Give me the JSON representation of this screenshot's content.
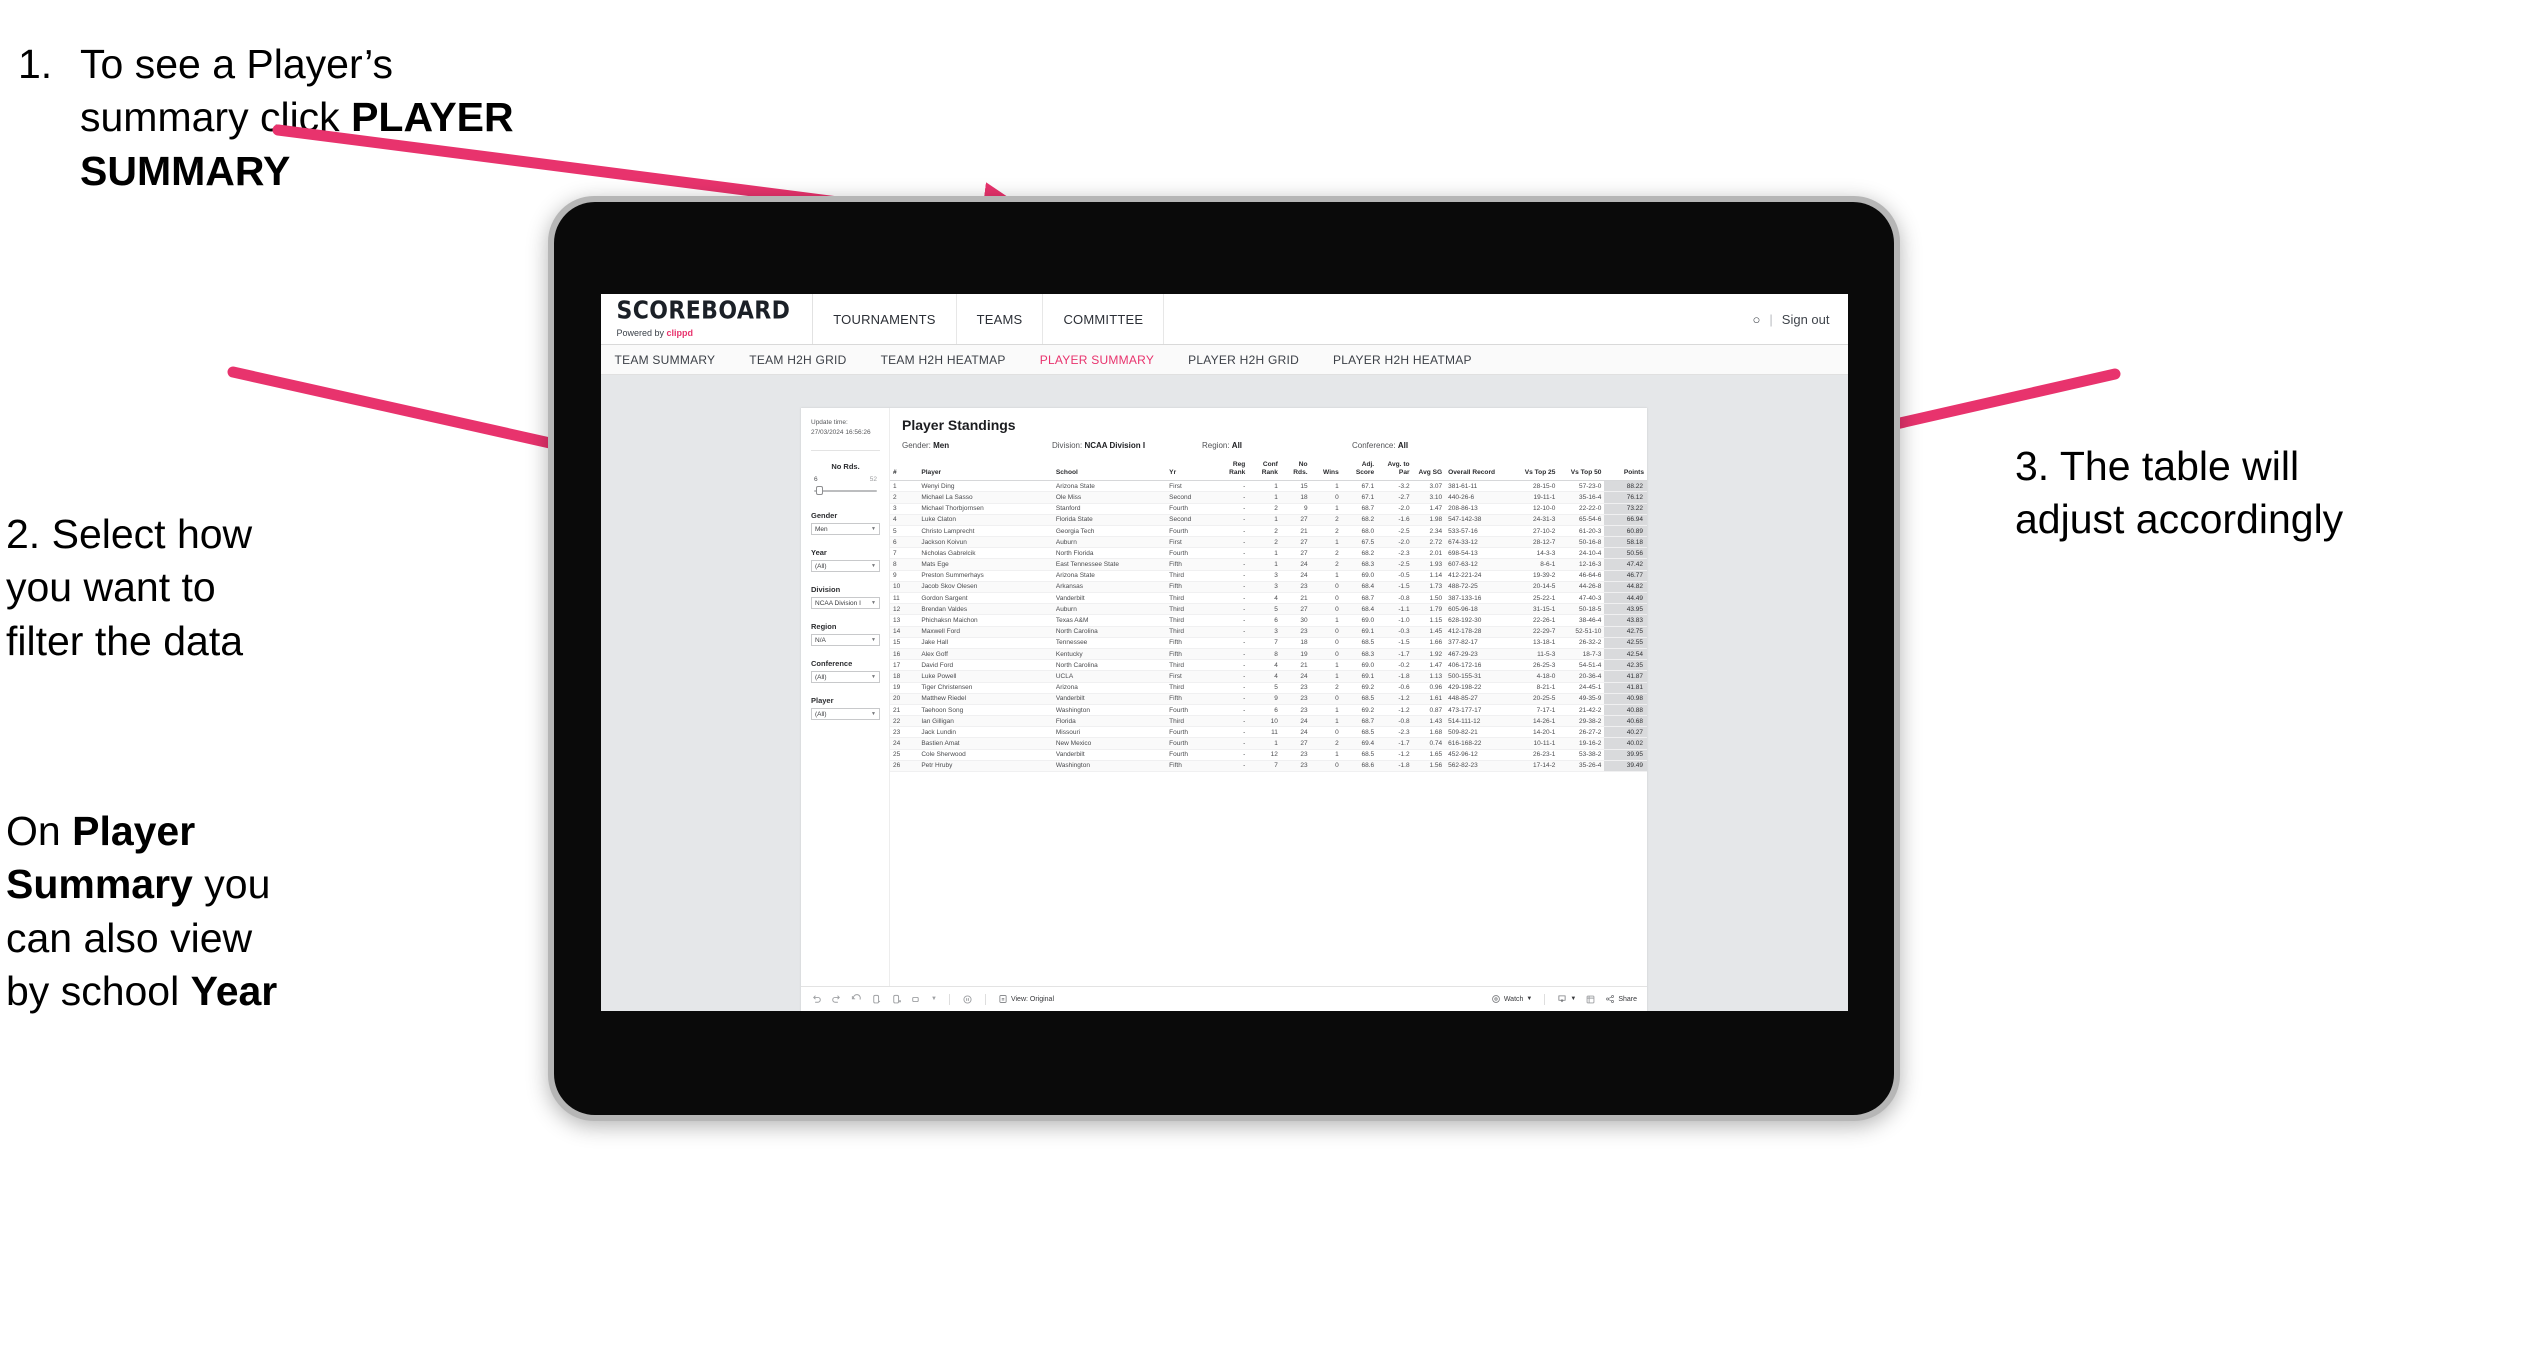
{
  "annotations": {
    "one": {
      "number": "1.",
      "line1": "To see a Player’s",
      "line2_pre": "summary click ",
      "line2_bold": "PLAYER",
      "line3_bold": "SUMMARY"
    },
    "two": {
      "number": "2.",
      "line1": "Select how",
      "line2": "you want to",
      "line3": "filter the data"
    },
    "two_b": {
      "l1_pre": "On ",
      "l1_bold": "Player",
      "l2_bold": "Summary",
      "l2_post": " you",
      "l3": "can also view",
      "l4_pre": "by school ",
      "l4_bold": "Year"
    },
    "three": {
      "line1": "3. The table will",
      "line2": "adjust accordingly"
    }
  },
  "app": {
    "brand": {
      "word": "SCOREBOARD",
      "powered_pre": "Powered by ",
      "powered_brand": "clippd"
    },
    "topnav": [
      "TOURNAMENTS",
      "TEAMS",
      "COMMITTEE"
    ],
    "topright": {
      "icon": "user-icon",
      "glyph": "○",
      "sep": "|",
      "signout": "Sign out"
    },
    "subnav": [
      {
        "label": "TEAM SUMMARY",
        "active": false
      },
      {
        "label": "TEAM H2H GRID",
        "active": false
      },
      {
        "label": "TEAM H2H HEATMAP",
        "active": false
      },
      {
        "label": "PLAYER SUMMARY",
        "active": true
      },
      {
        "label": "PLAYER H2H GRID",
        "active": false
      },
      {
        "label": "PLAYER H2H HEATMAP",
        "active": false
      }
    ],
    "accent": "#e8336d"
  },
  "filters": {
    "update_time_label": "Update time:",
    "update_time_value": "27/03/2024 16:56:26",
    "slider": {
      "title": "No Rds.",
      "min": "6",
      "max": "52"
    },
    "selects": [
      {
        "label": "Gender",
        "value": "Men"
      },
      {
        "label": "Year",
        "value": "(All)"
      },
      {
        "label": "Division",
        "value": "NCAA Division I"
      },
      {
        "label": "Region",
        "value": "N/A"
      },
      {
        "label": "Conference",
        "value": "(All)"
      },
      {
        "label": "Player",
        "value": "(All)"
      }
    ]
  },
  "viz": {
    "title": "Player Standings",
    "subhead": [
      {
        "label": "Gender: ",
        "value": "Men"
      },
      {
        "label": "Division: ",
        "value": "NCAA Division I"
      },
      {
        "label": "Region: ",
        "value": "All"
      },
      {
        "label": "Conference: ",
        "value": "All"
      }
    ],
    "columns": [
      "#",
      "Player",
      "School",
      "Yr",
      "Reg Rank",
      "Conf Rank",
      "No Rds.",
      "Wins",
      "Adj. Score",
      "Avg. to Par",
      "Avg SG",
      "Overall Record",
      "Vs Top 25",
      "Vs Top 50",
      "Points"
    ],
    "rows": [
      [
        "1",
        "Wenyi Ding",
        "Arizona State",
        "First",
        "-",
        "1",
        "15",
        "1",
        "67.1",
        "-3.2",
        "3.07",
        "381-61-11",
        "28-15-0",
        "57-23-0",
        "88.22"
      ],
      [
        "2",
        "Michael La Sasso",
        "Ole Miss",
        "Second",
        "-",
        "1",
        "18",
        "0",
        "67.1",
        "-2.7",
        "3.10",
        "440-26-6",
        "19-11-1",
        "35-16-4",
        "76.12"
      ],
      [
        "3",
        "Michael Thorbjornsen",
        "Stanford",
        "Fourth",
        "-",
        "2",
        "9",
        "1",
        "68.7",
        "-2.0",
        "1.47",
        "208-86-13",
        "12-10-0",
        "22-22-0",
        "73.22"
      ],
      [
        "4",
        "Luke Claton",
        "Florida State",
        "Second",
        "-",
        "1",
        "27",
        "2",
        "68.2",
        "-1.6",
        "1.98",
        "547-142-38",
        "24-31-3",
        "65-54-6",
        "66.94"
      ],
      [
        "5",
        "Christo Lamprecht",
        "Georgia Tech",
        "Fourth",
        "-",
        "2",
        "21",
        "2",
        "68.0",
        "-2.5",
        "2.34",
        "533-57-16",
        "27-10-2",
        "61-20-3",
        "60.89"
      ],
      [
        "6",
        "Jackson Koivun",
        "Auburn",
        "First",
        "-",
        "2",
        "27",
        "1",
        "67.5",
        "-2.0",
        "2.72",
        "674-33-12",
        "28-12-7",
        "50-16-8",
        "58.18"
      ],
      [
        "7",
        "Nicholas Gabrelcik",
        "North Florida",
        "Fourth",
        "-",
        "1",
        "27",
        "2",
        "68.2",
        "-2.3",
        "2.01",
        "698-54-13",
        "14-3-3",
        "24-10-4",
        "50.56"
      ],
      [
        "8",
        "Mats Ege",
        "East Tennessee State",
        "Fifth",
        "-",
        "1",
        "24",
        "2",
        "68.3",
        "-2.5",
        "1.93",
        "607-63-12",
        "8-6-1",
        "12-16-3",
        "47.42"
      ],
      [
        "9",
        "Preston Summerhays",
        "Arizona State",
        "Third",
        "-",
        "3",
        "24",
        "1",
        "69.0",
        "-0.5",
        "1.14",
        "412-221-24",
        "19-39-2",
        "46-64-6",
        "46.77"
      ],
      [
        "10",
        "Jacob Skov Olesen",
        "Arkansas",
        "Fifth",
        "-",
        "3",
        "23",
        "0",
        "68.4",
        "-1.5",
        "1.73",
        "488-72-25",
        "20-14-5",
        "44-26-8",
        "44.82"
      ],
      [
        "11",
        "Gordon Sargent",
        "Vanderbilt",
        "Third",
        "-",
        "4",
        "21",
        "0",
        "68.7",
        "-0.8",
        "1.50",
        "387-133-16",
        "25-22-1",
        "47-40-3",
        "44.49"
      ],
      [
        "12",
        "Brendan Valdes",
        "Auburn",
        "Third",
        "-",
        "5",
        "27",
        "0",
        "68.4",
        "-1.1",
        "1.79",
        "605-96-18",
        "31-15-1",
        "50-18-5",
        "43.95"
      ],
      [
        "13",
        "Phichaksn Maichon",
        "Texas A&M",
        "Third",
        "-",
        "6",
        "30",
        "1",
        "69.0",
        "-1.0",
        "1.15",
        "628-192-30",
        "22-26-1",
        "38-46-4",
        "43.83"
      ],
      [
        "14",
        "Maxwell Ford",
        "North Carolina",
        "Third",
        "-",
        "3",
        "23",
        "0",
        "69.1",
        "-0.3",
        "1.45",
        "412-178-28",
        "22-29-7",
        "52-51-10",
        "42.75"
      ],
      [
        "15",
        "Jake Hall",
        "Tennessee",
        "Fifth",
        "-",
        "7",
        "18",
        "0",
        "68.5",
        "-1.5",
        "1.66",
        "377-82-17",
        "13-18-1",
        "26-32-2",
        "42.55"
      ],
      [
        "16",
        "Alex Goff",
        "Kentucky",
        "Fifth",
        "-",
        "8",
        "19",
        "0",
        "68.3",
        "-1.7",
        "1.92",
        "467-29-23",
        "11-5-3",
        "18-7-3",
        "42.54"
      ],
      [
        "17",
        "David Ford",
        "North Carolina",
        "Third",
        "-",
        "4",
        "21",
        "1",
        "69.0",
        "-0.2",
        "1.47",
        "406-172-16",
        "26-25-3",
        "54-51-4",
        "42.35"
      ],
      [
        "18",
        "Luke Powell",
        "UCLA",
        "First",
        "-",
        "4",
        "24",
        "1",
        "69.1",
        "-1.8",
        "1.13",
        "500-155-31",
        "4-18-0",
        "20-36-4",
        "41.87"
      ],
      [
        "19",
        "Tiger Christensen",
        "Arizona",
        "Third",
        "-",
        "5",
        "23",
        "2",
        "69.2",
        "-0.6",
        "0.96",
        "429-198-22",
        "8-21-1",
        "24-45-1",
        "41.81"
      ],
      [
        "20",
        "Matthew Riedel",
        "Vanderbilt",
        "Fifth",
        "-",
        "9",
        "23",
        "0",
        "68.5",
        "-1.2",
        "1.61",
        "448-85-27",
        "20-25-5",
        "49-35-9",
        "40.98"
      ],
      [
        "21",
        "Taehoon Song",
        "Washington",
        "Fourth",
        "-",
        "6",
        "23",
        "1",
        "69.2",
        "-1.2",
        "0.87",
        "473-177-17",
        "7-17-1",
        "21-42-2",
        "40.88"
      ],
      [
        "22",
        "Ian Gilligan",
        "Florida",
        "Third",
        "-",
        "10",
        "24",
        "1",
        "68.7",
        "-0.8",
        "1.43",
        "514-111-12",
        "14-26-1",
        "29-38-2",
        "40.68"
      ],
      [
        "23",
        "Jack Lundin",
        "Missouri",
        "Fourth",
        "-",
        "11",
        "24",
        "0",
        "68.5",
        "-2.3",
        "1.68",
        "509-82-21",
        "14-20-1",
        "26-27-2",
        "40.27"
      ],
      [
        "24",
        "Bastien Amat",
        "New Mexico",
        "Fourth",
        "-",
        "1",
        "27",
        "2",
        "69.4",
        "-1.7",
        "0.74",
        "616-168-22",
        "10-11-1",
        "19-16-2",
        "40.02"
      ],
      [
        "25",
        "Cole Sherwood",
        "Vanderbilt",
        "Fourth",
        "-",
        "12",
        "23",
        "1",
        "68.5",
        "-1.2",
        "1.65",
        "452-96-12",
        "26-23-1",
        "53-38-2",
        "39.95"
      ],
      [
        "26",
        "Petr Hruby",
        "Washington",
        "Fifth",
        "-",
        "7",
        "23",
        "0",
        "68.6",
        "-1.8",
        "1.56",
        "562-82-23",
        "17-14-2",
        "35-26-4",
        "39.49"
      ]
    ]
  },
  "toolbar": {
    "icons": [
      "undo-icon",
      "redo-icon",
      "revert-icon",
      "refresh-icon",
      "pause-icon",
      "rectangle-select-icon"
    ],
    "view_label": "View: Original",
    "watch_label": "Watch",
    "share_label": "Share",
    "download_icon": "download-icon",
    "fullscreen_icon": "fullscreen-icon",
    "share_icon": "share-icon"
  }
}
